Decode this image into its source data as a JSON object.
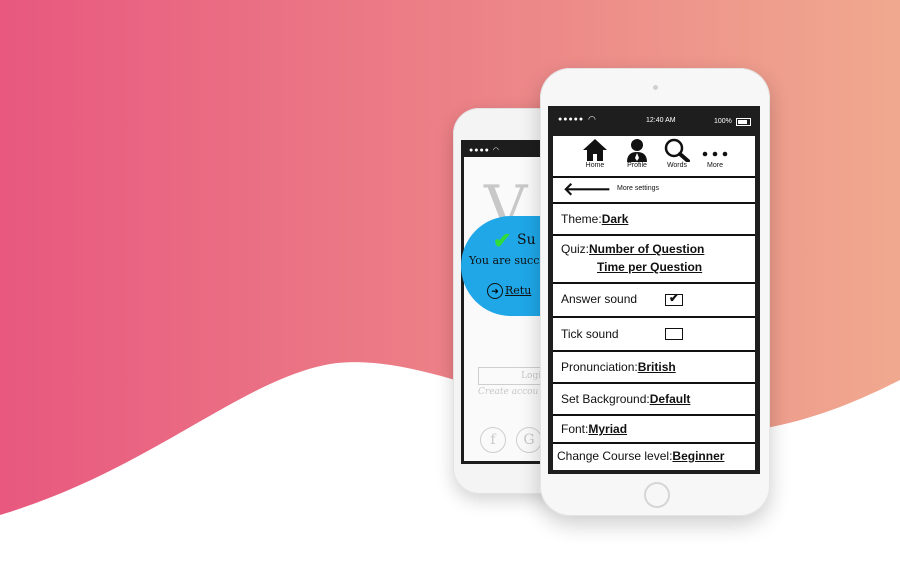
{
  "colors": {
    "gradient_left": "#e8587f",
    "gradient_right": "#f0a98f",
    "bubble": "#1fa7e8",
    "check": "#2fdc3a"
  },
  "back_phone": {
    "success_title": "Su",
    "success_text": "You are succ",
    "return_link": "Retu",
    "sketch_login": "Login",
    "sketch_create": "Create accou"
  },
  "status_bar": {
    "time": "12:40 AM",
    "battery": "100%"
  },
  "nav": {
    "items": [
      {
        "label": "Home",
        "icon": "home-icon"
      },
      {
        "label": "Profile",
        "icon": "profile-icon"
      },
      {
        "label": "Words",
        "icon": "search-icon"
      },
      {
        "label": "More",
        "icon": "more-icon"
      }
    ]
  },
  "subheader": {
    "title": "More settings"
  },
  "settings": {
    "theme": {
      "label": "Theme:",
      "value": "Dark"
    },
    "quiz": {
      "label": "Quiz:",
      "value1": "Number of Question",
      "value2": "Time per Question"
    },
    "answer_sound": {
      "label": "Answer sound",
      "checked": true
    },
    "tick_sound": {
      "label": "Tick sound",
      "checked": false
    },
    "pronunciation": {
      "label": "Pronunciation:",
      "value": "British"
    },
    "background": {
      "label": "Set Background:",
      "value": "Default"
    },
    "font": {
      "label": "Font:",
      "value": "Myriad"
    },
    "course_level": {
      "label": "Change Course level:",
      "value": "Beginner"
    }
  }
}
